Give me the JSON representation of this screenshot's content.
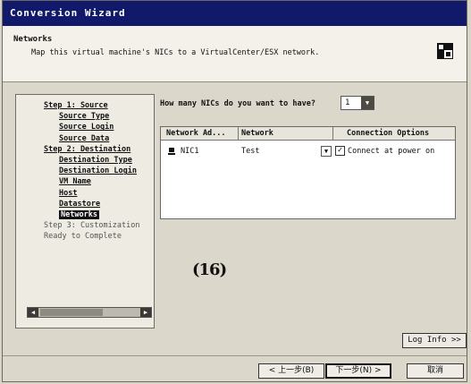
{
  "window": {
    "title": "Conversion Wizard"
  },
  "header": {
    "title": "Networks",
    "subtitle": "Map this virtual machine's NICs to a VirtualCenter/ESX network."
  },
  "sidebar": {
    "items": [
      {
        "label": "Step 1: Source",
        "level": 0,
        "state": "done"
      },
      {
        "label": "Source Type",
        "level": 1,
        "state": "done"
      },
      {
        "label": "Source Login",
        "level": 1,
        "state": "done"
      },
      {
        "label": "Source Data",
        "level": 1,
        "state": "done"
      },
      {
        "label": "Step 2: Destination",
        "level": 0,
        "state": "done"
      },
      {
        "label": "Destination Type",
        "level": 1,
        "state": "done"
      },
      {
        "label": "Destination Login",
        "level": 1,
        "state": "done"
      },
      {
        "label": "VM Name",
        "level": 1,
        "state": "done"
      },
      {
        "label": "Host",
        "level": 1,
        "state": "done"
      },
      {
        "label": "Datastore",
        "level": 1,
        "state": "done"
      },
      {
        "label": "Networks",
        "level": 1,
        "state": "current"
      },
      {
        "label": "Step 3: Customization",
        "level": 0,
        "state": "inactive"
      },
      {
        "label": "Ready to Complete",
        "level": 0,
        "state": "inactive"
      }
    ]
  },
  "nics": {
    "question": "How many NICs do you want to have?",
    "count": "1"
  },
  "table": {
    "columns": [
      "Network Ad...",
      "Network",
      "Connection Options"
    ],
    "rows": [
      {
        "adapter": "NIC1",
        "network": "Test",
        "connect": "Connect at power on",
        "checked": true
      }
    ]
  },
  "figure_label": "(16)",
  "buttons": {
    "log": "Log Info >>",
    "back": "< 上一步(B)",
    "next": "下一步(N) >",
    "cancel": "取消"
  },
  "colors": {
    "titlebar": "#111a6a",
    "current_item": "#111111"
  }
}
